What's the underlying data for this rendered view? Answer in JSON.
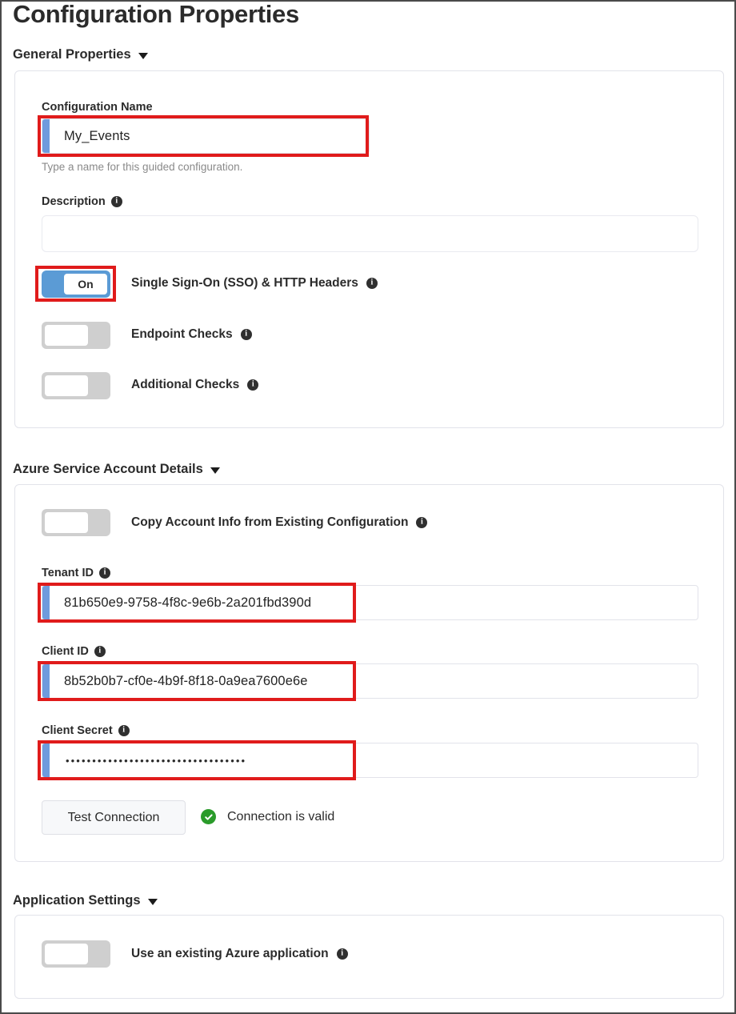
{
  "page": {
    "title": "Configuration Properties"
  },
  "sections": {
    "general": {
      "heading": "General Properties",
      "caret": "chevron-down-icon",
      "config_name": {
        "label": "Configuration Name",
        "value": "My_Events",
        "help": "Type a name for this guided configuration."
      },
      "description": {
        "label": "Description",
        "value": "",
        "info": "info-icon"
      },
      "toggles": [
        {
          "label": "Single Sign-On (SSO) & HTTP Headers",
          "state": "on",
          "state_label": "On",
          "info": "info-icon"
        },
        {
          "label": "Endpoint Checks",
          "state": "off",
          "state_label": "",
          "info": "info-icon"
        },
        {
          "label": "Additional Checks",
          "state": "off",
          "state_label": "",
          "info": "info-icon"
        }
      ]
    },
    "azure": {
      "heading": "Azure Service Account Details",
      "caret": "chevron-down-icon",
      "copy_toggle": {
        "label": "Copy Account Info from Existing Configuration",
        "state": "off",
        "state_label": "",
        "info": "info-icon"
      },
      "tenant_id": {
        "label": "Tenant ID",
        "value": "81b650e9-9758-4f8c-9e6b-2a201fbd390d",
        "info": "info-icon"
      },
      "client_id": {
        "label": "Client ID",
        "value": "8b52b0b7-cf0e-4b9f-8f18-0a9ea7600e6e",
        "info": "info-icon"
      },
      "client_secret": {
        "label": "Client Secret",
        "value": "••••••••••••••••••••••••••••••••••",
        "info": "info-icon"
      },
      "test_button": "Test Connection",
      "status_text": "Connection is valid",
      "status_icon": "check-circle-icon"
    },
    "application": {
      "heading": "Application Settings",
      "caret": "chevron-down-icon",
      "use_existing": {
        "label": "Use an existing Azure application",
        "state": "off",
        "state_label": "",
        "info": "info-icon"
      }
    }
  },
  "colors": {
    "accent_blue": "#6e9bdd",
    "toggle_on": "#5b9bd5",
    "toggle_off": "#cfcfcf",
    "annotation_red": "#e01b1b",
    "status_green": "#2a9b2a"
  }
}
